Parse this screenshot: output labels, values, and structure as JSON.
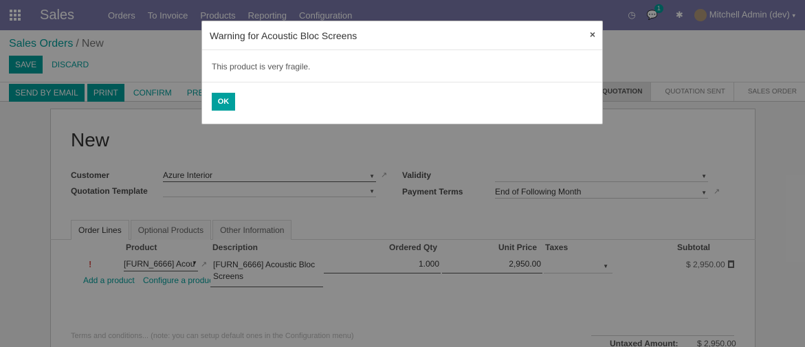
{
  "navbar": {
    "app_name": "Sales",
    "menu": [
      "Orders",
      "To Invoice",
      "Products",
      "Reporting",
      "Configuration"
    ],
    "notification_count": "1",
    "user_name": "Mitchell Admin (dev)",
    "colors": {
      "bar": "#7c7bad",
      "accent": "#00a09d"
    }
  },
  "breadcrumb": {
    "parent": "Sales Orders",
    "separator": "/",
    "current": "New"
  },
  "control_panel": {
    "save_label": "SAVE",
    "discard_label": "DISCARD"
  },
  "statusbar": {
    "buttons": [
      "SEND BY EMAIL",
      "PRINT",
      "CONFIRM",
      "PREVIEW"
    ],
    "stages": [
      {
        "label": "QUOTATION",
        "active": true
      },
      {
        "label": "QUOTATION SENT",
        "active": false
      },
      {
        "label": "SALES ORDER",
        "active": false
      }
    ]
  },
  "form": {
    "title": "New",
    "customer_label": "Customer",
    "customer_value": "Azure Interior",
    "quotation_template_label": "Quotation Template",
    "quotation_template_value": "",
    "validity_label": "Validity",
    "validity_value": "",
    "payment_terms_label": "Payment Terms",
    "payment_terms_value": "End of Following Month"
  },
  "tabs": [
    "Order Lines",
    "Optional Products",
    "Other Information"
  ],
  "order_lines": {
    "headers": {
      "product": "Product",
      "description": "Description",
      "ordered_qty": "Ordered Qty",
      "unit_price": "Unit Price",
      "taxes": "Taxes",
      "subtotal": "Subtotal"
    },
    "row": {
      "warning": "!",
      "product": "[FURN_6666] Acou",
      "description_line1": "[FURN_6666] Acoustic Bloc",
      "description_line2": "Screens",
      "ordered_qty": "1.000",
      "unit_price": "2,950.00",
      "taxes": "",
      "subtotal": "$ 2,950.00"
    },
    "add_product": "Add a product",
    "configure_product": "Configure a produc"
  },
  "footer": {
    "terms_placeholder": "Terms and conditions... (note: you can setup default ones in the Configuration menu)",
    "untaxed_label": "Untaxed Amount:",
    "untaxed_value": "$ 2,950.00"
  },
  "modal": {
    "title": "Warning for Acoustic Bloc Screens",
    "close": "×",
    "message": "This product is very fragile.",
    "ok_label": "OK"
  }
}
